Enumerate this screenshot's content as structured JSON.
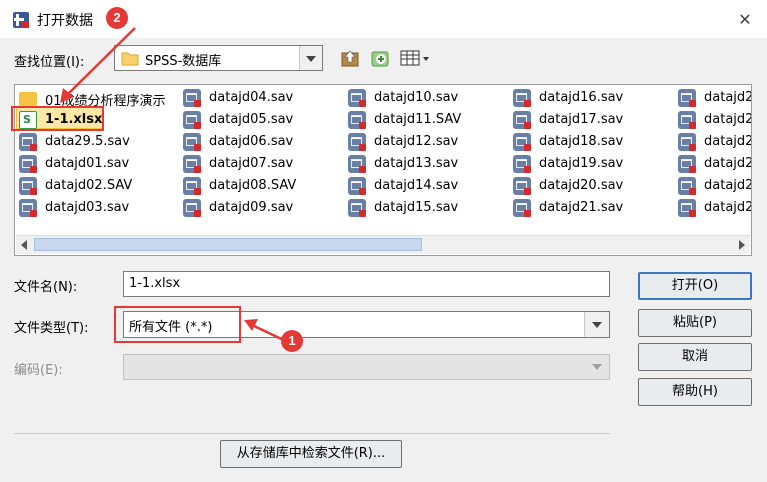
{
  "window": {
    "title": "打开数据"
  },
  "lookin": {
    "label": "查找位置(I):",
    "value": "SPSS-数据库"
  },
  "files": {
    "columns": [
      [
        "01成绩分析程序演示",
        "1-1.xlsx",
        "data29.5.sav",
        "datajd01.sav",
        "datajd02.SAV",
        "datajd03.sav"
      ],
      [
        "datajd04.sav",
        "datajd05.sav",
        "datajd06.sav",
        "datajd07.sav",
        "datajd08.SAV",
        "datajd09.sav"
      ],
      [
        "datajd10.sav",
        "datajd11.SAV",
        "datajd12.sav",
        "datajd13.sav",
        "datajd14.sav",
        "datajd15.sav"
      ],
      [
        "datajd16.sav",
        "datajd17.sav",
        "datajd18.sav",
        "datajd19.sav",
        "datajd20.sav",
        "datajd21.sav"
      ],
      [
        "datajd2",
        "datajd2",
        "datajd2",
        "datajd2",
        "datajd2",
        "datajd2"
      ]
    ],
    "types": [
      [
        "folder",
        "xlsx",
        "sav",
        "sav",
        "sav",
        "sav"
      ],
      [
        "sav",
        "sav",
        "sav",
        "sav",
        "sav",
        "sav"
      ],
      [
        "sav",
        "sav",
        "sav",
        "sav",
        "sav",
        "sav"
      ],
      [
        "sav",
        "sav",
        "sav",
        "sav",
        "sav",
        "sav"
      ],
      [
        "sav",
        "sav",
        "sav",
        "sav",
        "sav",
        "sav"
      ]
    ],
    "selected": "1-1.xlsx"
  },
  "form": {
    "filename_label": "文件名(N):",
    "filename_value": "1-1.xlsx",
    "filetype_label": "文件类型(T):",
    "filetype_value": "所有文件 (*.*)",
    "encoding_label": "编码(E):"
  },
  "buttons": {
    "open": "打开(O)",
    "paste": "粘贴(P)",
    "cancel": "取消",
    "help": "帮助(H)",
    "search_repo": "从存储库中检索文件(R)..."
  },
  "annotations": {
    "badge1": "1",
    "badge2": "2"
  }
}
